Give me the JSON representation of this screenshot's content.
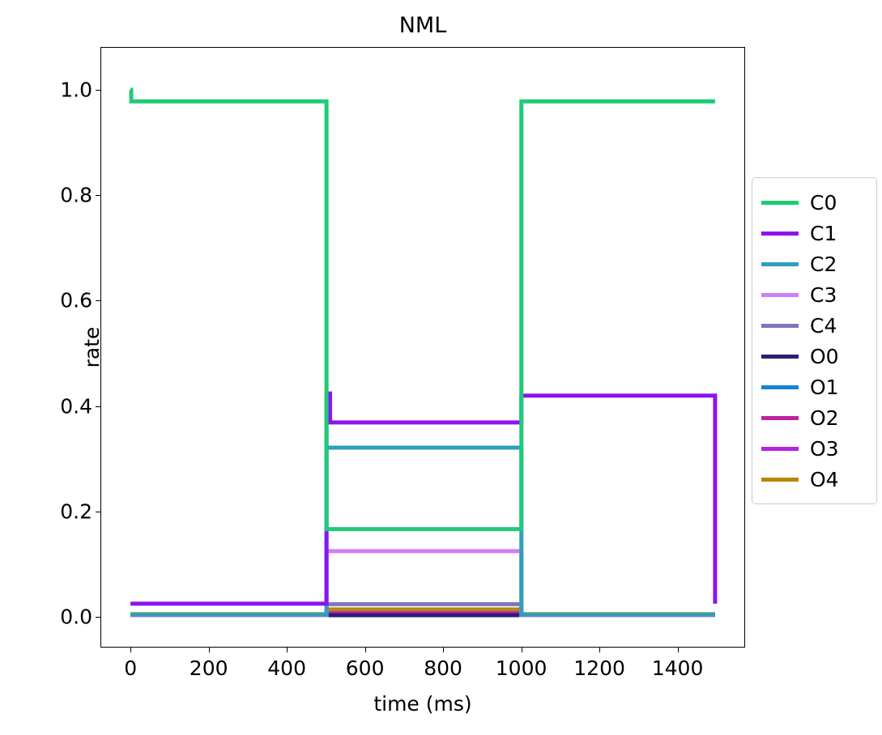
{
  "chart_data": {
    "type": "line",
    "title": "NML",
    "xlabel": "time (ms)",
    "ylabel": "rate",
    "xlim": [
      -75,
      1575
    ],
    "ylim": [
      -0.06,
      1.08
    ],
    "xticks": [
      0,
      200,
      400,
      600,
      800,
      1000,
      1200,
      1400
    ],
    "xtick_labels": [
      "0",
      "200",
      "400",
      "600",
      "800",
      "1000",
      "1200",
      "1400"
    ],
    "yticks": [
      0.0,
      0.2,
      0.4,
      0.6,
      0.8,
      1.0
    ],
    "ytick_labels": [
      "0.0",
      "0.2",
      "0.4",
      "0.6",
      "0.8",
      "1.0"
    ],
    "grid": false,
    "legend_position": "right-outside",
    "step_times": [
      0,
      500,
      1000,
      1500
    ],
    "series": [
      {
        "name": "C0",
        "color": "#1ecb78",
        "x": [
          0,
          2,
          500,
          503,
          1000,
          1003,
          1500
        ],
        "values": [
          1.0,
          0.978,
          0.978,
          0.164,
          0.164,
          0.978,
          0.978
        ]
      },
      {
        "name": "C1",
        "color": "#8a15f0",
        "x": [
          0,
          500,
          503,
          512,
          1000,
          1003,
          1500
        ],
        "values": [
          0.022,
          0.022,
          0.422,
          0.367,
          0.367,
          0.418,
          0.022
        ]
      },
      {
        "name": "C2",
        "color": "#2e9fbd",
        "x": [
          0,
          500,
          503,
          1000,
          1003,
          1500
        ],
        "values": [
          0.001,
          0.001,
          0.319,
          0.319,
          0.001,
          0.001
        ]
      },
      {
        "name": "C3",
        "color": "#d17ef5",
        "x": [
          0,
          500,
          503,
          1000,
          1003,
          1500
        ],
        "values": [
          0.0,
          0.0,
          0.122,
          0.122,
          0.0,
          0.0
        ]
      },
      {
        "name": "C4",
        "color": "#7e76bd",
        "x": [
          0,
          500,
          503,
          1000,
          1003,
          1500
        ],
        "values": [
          0.0,
          0.0,
          0.021,
          0.021,
          0.0,
          0.0
        ]
      },
      {
        "name": "O0",
        "color": "#2b1f70",
        "x": [
          0,
          500,
          503,
          1000,
          1003,
          1500
        ],
        "values": [
          0.0,
          0.0,
          0.0,
          0.0,
          0.0,
          0.0
        ]
      },
      {
        "name": "O1",
        "color": "#1783d4",
        "x": [
          0,
          500,
          503,
          1000,
          1003,
          1500
        ],
        "values": [
          0.0,
          0.0,
          0.0,
          0.0,
          0.0,
          0.0
        ]
      },
      {
        "name": "O2",
        "color": "#c1219e",
        "x": [
          0,
          500,
          503,
          1000,
          1003,
          1500
        ],
        "values": [
          0.0,
          0.0,
          0.002,
          0.002,
          0.0,
          0.0
        ]
      },
      {
        "name": "O3",
        "color": "#b721e0",
        "x": [
          0,
          500,
          503,
          1000,
          1003,
          1500
        ],
        "values": [
          0.0,
          0.0,
          0.004,
          0.004,
          0.0,
          0.0
        ]
      },
      {
        "name": "O4",
        "color": "#b8860b",
        "x": [
          0,
          500,
          503,
          1000,
          1003,
          1500
        ],
        "values": [
          0.002,
          0.002,
          0.011,
          0.011,
          0.002,
          0.002
        ]
      }
    ]
  },
  "legend": {
    "entries": [
      {
        "label": "C0",
        "color": "#1ecb78"
      },
      {
        "label": "C1",
        "color": "#8a15f0"
      },
      {
        "label": "C2",
        "color": "#2e9fbd"
      },
      {
        "label": "C3",
        "color": "#d17ef5"
      },
      {
        "label": "C4",
        "color": "#7e76bd"
      },
      {
        "label": "O0",
        "color": "#2b1f70"
      },
      {
        "label": "O1",
        "color": "#1783d4"
      },
      {
        "label": "O2",
        "color": "#c1219e"
      },
      {
        "label": "O3",
        "color": "#b721e0"
      },
      {
        "label": "O4",
        "color": "#b8860b"
      }
    ]
  }
}
